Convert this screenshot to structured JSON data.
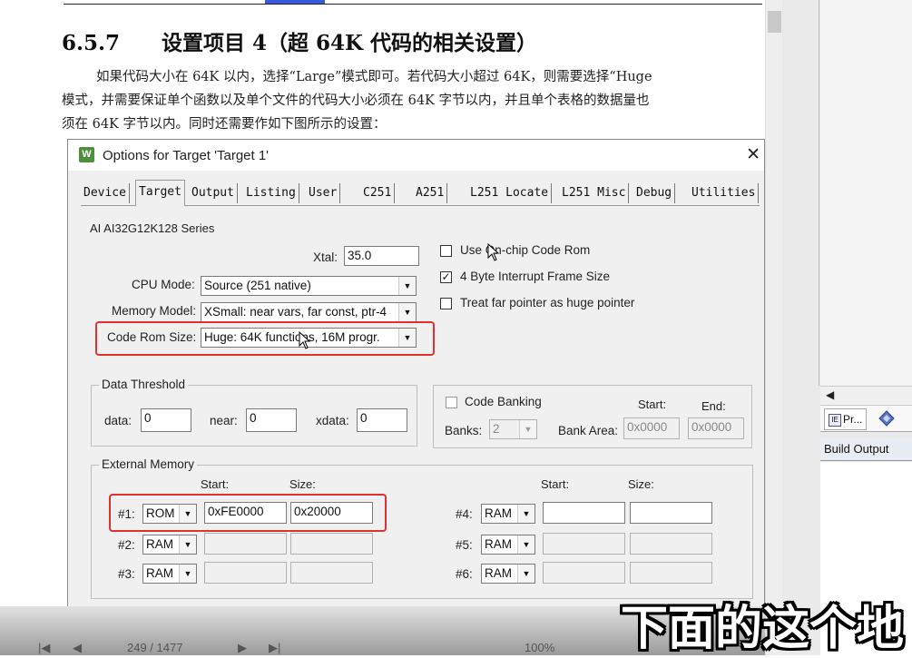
{
  "document": {
    "heading_number": "6.5.7",
    "heading_title": "设置项目 4（超 64K 代码的相关设置）",
    "paragraph_lines": [
      "如果代码大小在 64K 以内，选择“Large”模式即可。若代码大小超过 64K，则需要选择“Huge",
      "模式，并需要保证单个函数以及单个文件的代码大小必须在 64K 字节以内，并且单个表格的数据量也",
      "须在 64K 字节以内。同时还需要作如下图所示的设置："
    ]
  },
  "dialog": {
    "title": "Options for Target 'Target 1'",
    "app_icon": "W",
    "close_glyph": "✕",
    "tabs": [
      "Device",
      "Target",
      "Output",
      "Listing",
      "User",
      "C251",
      "A251",
      "L251 Locate",
      "L251 Misc",
      "Debug",
      "Utilities"
    ],
    "active_tab": "Target",
    "device_name": "AI AI32G12K128 Series",
    "xtal_label": "Xtal:",
    "xtal_value": "35.0",
    "cpu_mode_label": "CPU Mode:",
    "cpu_mode_value": "Source (251 native)",
    "memory_model_label": "Memory Model:",
    "memory_model_value": "XSmall: near vars, far const, ptr-4",
    "code_rom_size_label": "Code Rom Size:",
    "code_rom_size_value": "Huge: 64K functions, 16M progr.",
    "options": [
      {
        "label": "Use On-chip Code Rom",
        "checked": false
      },
      {
        "label": "4 Byte Interrupt Frame Size",
        "checked": true
      },
      {
        "label": "Treat far pointer as huge pointer",
        "checked": false
      }
    ],
    "data_threshold": {
      "title": "Data Threshold",
      "data_label": "data:",
      "data_value": "0",
      "near_label": "near:",
      "near_value": "0",
      "xdata_label": "xdata:",
      "xdata_value": "0"
    },
    "code_banking": {
      "label": "Code Banking",
      "checked": false,
      "start_label": "Start:",
      "end_label": "End:",
      "banks_label": "Banks:",
      "banks_value": "2",
      "bank_area_label": "Bank Area:",
      "start_value": "0x0000",
      "end_value": "0x0000"
    },
    "external_memory": {
      "title": "External Memory",
      "start_label": "Start:",
      "size_label": "Size:",
      "rows": [
        {
          "label": "#1:",
          "type": "ROM",
          "start": "0xFE0000",
          "size": "0x20000"
        },
        {
          "label": "#2:",
          "type": "RAM",
          "start": "",
          "size": ""
        },
        {
          "label": "#3:",
          "type": "RAM",
          "start": "",
          "size": ""
        },
        {
          "label": "#4:",
          "type": "RAM",
          "start": "",
          "size": ""
        },
        {
          "label": "#5:",
          "type": "RAM",
          "start": "",
          "size": ""
        },
        {
          "label": "#6:",
          "type": "RAM",
          "start": "",
          "size": ""
        }
      ]
    }
  },
  "right_panel": {
    "tab_label": "Pr...",
    "build_output_label": "Build Output"
  },
  "viewer_bar": {
    "page_indicator": "249 / 1477",
    "zoom": "100%"
  },
  "subtitle": "下面的这个地",
  "colors": {
    "highlight_box": "#e03030",
    "dialog_bg": "#f0f0f0",
    "app_icon_green": "#4d8f3a"
  }
}
